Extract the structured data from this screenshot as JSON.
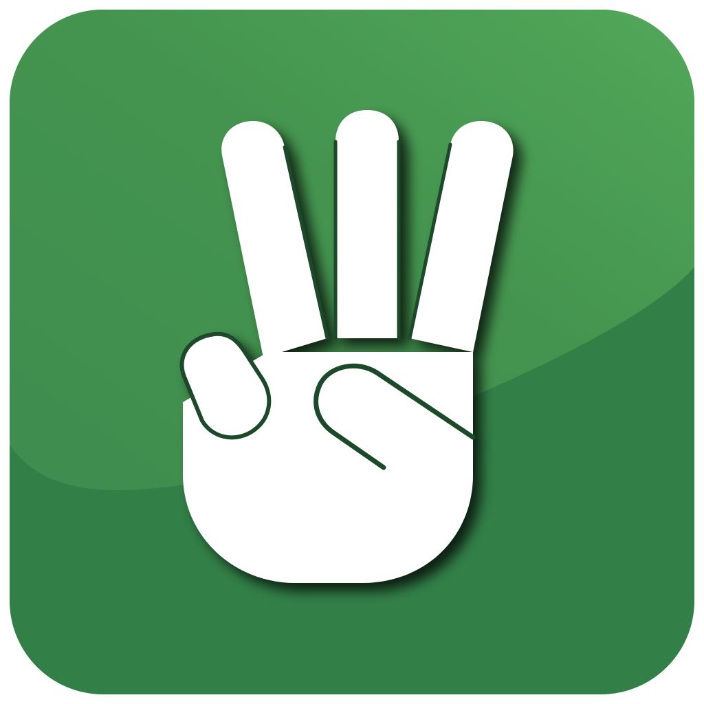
{
  "icon": {
    "name": "three-fingers-hand-icon",
    "colors": {
      "background_base": "#327f48",
      "background_dark": "#2e7a44",
      "highlight_light": "#52a85a",
      "highlight_mid": "#3f8d4f",
      "glyph": "#ffffff",
      "glyph_outline": "#1d4a2a",
      "shadow": "#0f2c18"
    }
  }
}
